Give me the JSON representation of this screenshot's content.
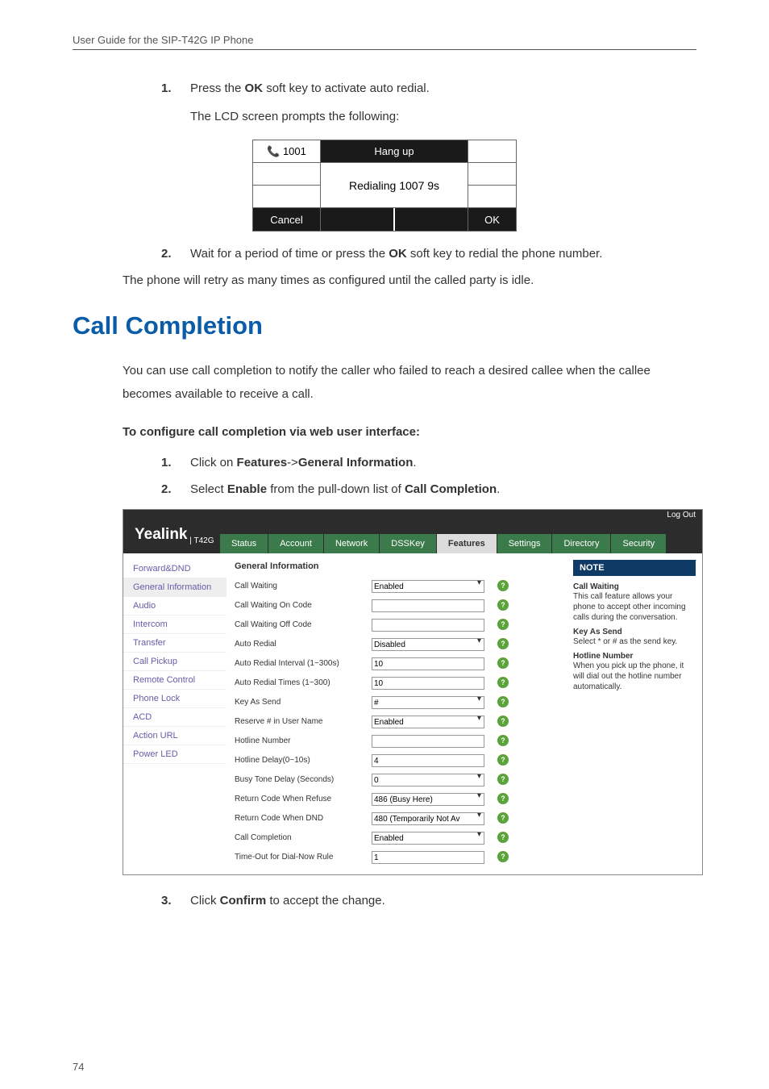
{
  "header": "User Guide for the SIP-T42G IP Phone",
  "step1_pre": "Press the ",
  "step1_bold": "OK",
  "step1_post": " soft key to activate auto redial.",
  "step1_sub": "The LCD screen prompts the following:",
  "lcd": {
    "ext": "1001",
    "hang": "Hang up",
    "msg": "Redialing 1007 9s",
    "cancel": "Cancel",
    "ok": "OK"
  },
  "step2_pre": "Wait for a period of time or press the ",
  "step2_bold": "OK",
  "step2_post": " soft key to redial the phone number.",
  "para1": "The phone will retry as many times as configured until the called party is idle.",
  "h2": "Call Completion",
  "para2": "You can use call completion to notify the caller who failed to reach a desired callee when the callee becomes available to receive a call.",
  "bold1": "To configure call completion via web user interface:",
  "stepc1_pre": "Click on ",
  "stepc1_b1": "Features",
  "stepc1_mid": "->",
  "stepc1_b2": "General Information",
  "stepc1_end": ".",
  "stepc2_pre": "Select ",
  "stepc2_b1": "Enable",
  "stepc2_mid": " from the pull-down list of ",
  "stepc2_b2": "Call Completion",
  "stepc2_end": ".",
  "logout": "Log Out",
  "logo": "Yealink",
  "logo_sub": " | T42G",
  "tabs": [
    "Status",
    "Account",
    "Network",
    "DSSKey",
    "Features",
    "Settings",
    "Directory",
    "Security"
  ],
  "sidebar": [
    "Forward&DND",
    "General Information",
    "Audio",
    "Intercom",
    "Transfer",
    "Call Pickup",
    "Remote Control",
    "Phone Lock",
    "ACD",
    "Action URL",
    "Power LED"
  ],
  "mainh": "General Information",
  "rows": [
    {
      "lbl": "Call Waiting",
      "type": "sel",
      "val": "Enabled"
    },
    {
      "lbl": "Call Waiting On Code",
      "type": "txt",
      "val": ""
    },
    {
      "lbl": "Call Waiting Off Code",
      "type": "txt",
      "val": ""
    },
    {
      "lbl": "Auto Redial",
      "type": "sel",
      "val": "Disabled"
    },
    {
      "lbl": "Auto Redial Interval (1~300s)",
      "type": "txt",
      "val": "10"
    },
    {
      "lbl": "Auto Redial Times (1~300)",
      "type": "txt",
      "val": "10"
    },
    {
      "lbl": "Key As Send",
      "type": "sel",
      "val": "#"
    },
    {
      "lbl": "Reserve # in User Name",
      "type": "sel",
      "val": "Enabled"
    },
    {
      "lbl": "Hotline Number",
      "type": "txt",
      "val": ""
    },
    {
      "lbl": "Hotline Delay(0~10s)",
      "type": "txt",
      "val": "4"
    },
    {
      "lbl": "Busy Tone Delay (Seconds)",
      "type": "sel",
      "val": "0"
    },
    {
      "lbl": "Return Code When Refuse",
      "type": "sel",
      "val": "486 (Busy Here)"
    },
    {
      "lbl": "Return Code When DND",
      "type": "sel",
      "val": "480 (Temporarily Not Av"
    },
    {
      "lbl": "Call Completion",
      "type": "sel",
      "val": "Enabled"
    },
    {
      "lbl": "Time-Out for Dial-Now Rule",
      "type": "txt",
      "val": "1"
    }
  ],
  "noteTitle": "NOTE",
  "notes": [
    {
      "t": "Call Waiting",
      "p": "This call feature allows your phone to accept other incoming calls during the conversation."
    },
    {
      "t": "Key As Send",
      "p": "Select * or # as the send key."
    },
    {
      "t": "Hotline Number",
      "p": "When you pick up the phone, it will dial out the hotline number automatically."
    }
  ],
  "step3_pre": "Click ",
  "step3_bold": "Confirm",
  "step3_post": " to accept the change.",
  "pagenum": "74"
}
